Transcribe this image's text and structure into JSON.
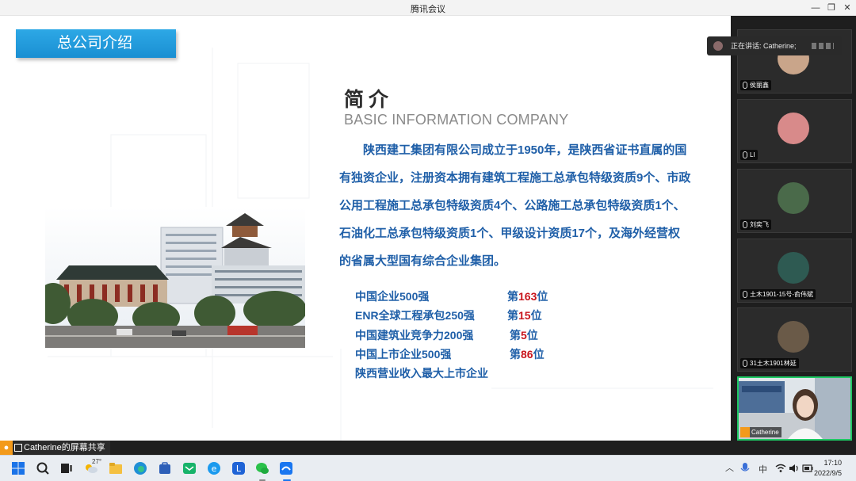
{
  "window": {
    "title": "腾讯会议",
    "minimize_glyph": "—",
    "restore_glyph": "❐",
    "close_glyph": "✕"
  },
  "slide": {
    "header": "总公司介绍",
    "intro_title": "简介",
    "intro_subtitle": "BASIC INFORMATION COMPANY",
    "intro_paragraph": "陕西建工集团有限公司成立于1950年，是陕西省证书直属的国有独资企业，注册资本拥有建筑工程施工总承包特级资质9个、市政公用工程施工总承包特级资质4个、公路施工总承包特级资质1个、石油化工总承包特级资质1个、甲级设计资质17个，及海外经营权的省属大型国有综合企业集团。",
    "rankings": [
      {
        "label": "中国企业500强",
        "prefix": "第",
        "num": "163",
        "suffix": "位"
      },
      {
        "label": "ENR全球工程承包250强",
        "prefix": "第",
        "num": "15",
        "suffix": "位"
      },
      {
        "label": "中国建筑业竞争力200强",
        "prefix": "第",
        "num": "5",
        "suffix": "位"
      },
      {
        "label": "中国上市企业500强",
        "prefix": "第",
        "num": "86",
        "suffix": "位"
      },
      {
        "label": "陕西营业收入最大上市企业",
        "prefix": "",
        "num": "",
        "suffix": ""
      }
    ]
  },
  "speaking": {
    "text": "正在讲话: Catherine;"
  },
  "participants": [
    {
      "name": "侯丽鑫",
      "avatar_color": "#c9a58a"
    },
    {
      "name": "LI",
      "avatar_color": "#d88a8a"
    },
    {
      "name": "刘奕飞",
      "avatar_color": "#4a6a4a"
    },
    {
      "name": "土木1901-15号-俞伟斌",
      "avatar_color": "#2e5a52"
    },
    {
      "name": "31土木1901林延",
      "avatar_color": "#6a5a48"
    }
  ],
  "self_tile": {
    "name": "Catherine"
  },
  "share_bar": {
    "label": "Catherine的屏幕共享"
  },
  "taskbar": {
    "weather": "27°",
    "ime": "中",
    "time": "17:10",
    "date": "2022/9/5",
    "tray_chevron": "︿"
  },
  "colors": {
    "header_blue": "#1a8fd2",
    "text_blue": "#1f5fa8",
    "rank_red": "#c9161d",
    "active_green": "#1ec964"
  }
}
